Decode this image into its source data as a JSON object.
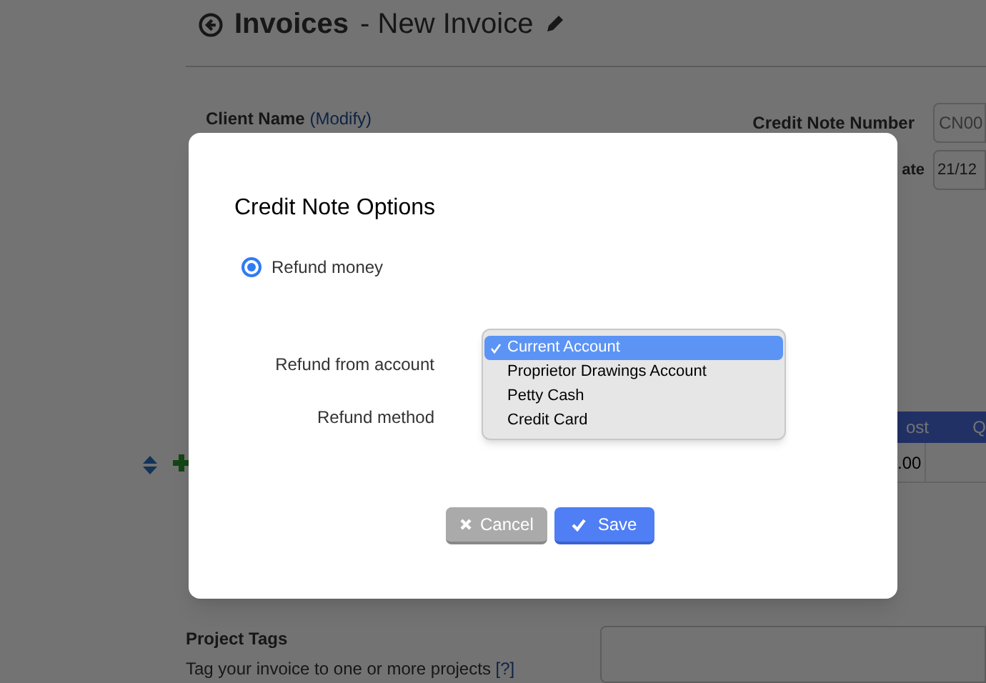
{
  "page": {
    "title": "Invoices",
    "subtitle": "- New Invoice",
    "client_label": "Client Name",
    "client_link": "(Modify)",
    "credit_note_label": "Credit Note Number",
    "credit_note_value": "CN00",
    "date_label": "ate",
    "date_value": "21/12",
    "table_headers": [
      "ost",
      "Q"
    ],
    "row_cell": ".00",
    "project_tags_label": "Project Tags",
    "project_tags_help": "Tag your invoice to one or more projects",
    "help_link": "[?]"
  },
  "dialog": {
    "title": "Credit Note Options",
    "radio": {
      "label": "Refund money",
      "selected": true
    },
    "fields": [
      {
        "label": "Refund from account"
      },
      {
        "label": "Refund method"
      }
    ],
    "dropdown": {
      "options": [
        {
          "label": "Current Account",
          "selected": true
        },
        {
          "label": "Proprietor Drawings Account",
          "selected": false
        },
        {
          "label": "Petty Cash",
          "selected": false
        },
        {
          "label": "Credit Card",
          "selected": false
        }
      ]
    },
    "buttons": [
      {
        "label": "Cancel",
        "kind": "cancel"
      },
      {
        "label": "Save",
        "kind": "save"
      }
    ]
  }
}
